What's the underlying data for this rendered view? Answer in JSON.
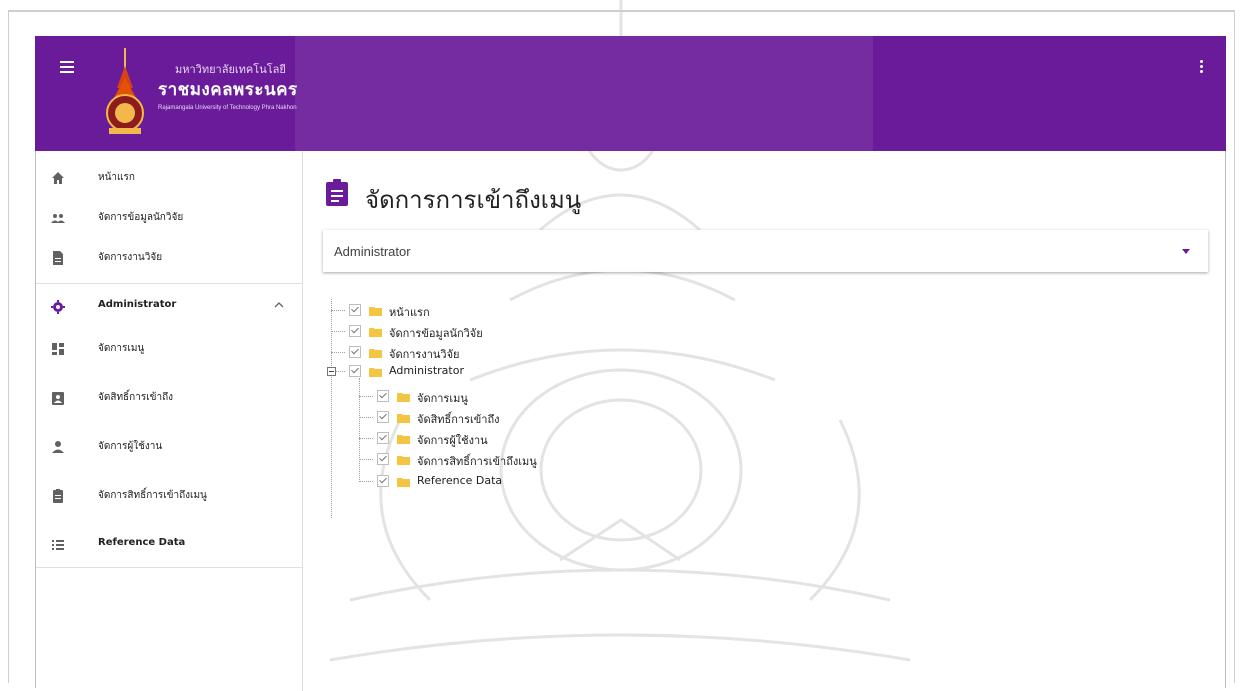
{
  "header": {
    "brand_small": "มหาวิทยาลัยเทคโนโลยี",
    "brand_big": "ราชมงคลพระนคร",
    "brand_en": "Rajamangala University of Technology Phra Nakhon",
    "accent_color": "#6a1b9a"
  },
  "sidebar": {
    "items": [
      {
        "label": "หน้าแรก",
        "icon": "home-icon"
      },
      {
        "label": "จัดการข้อมูลนักวิจัย",
        "icon": "people-icon"
      },
      {
        "label": "จัดการงานวิจัย",
        "icon": "document-icon"
      },
      {
        "label": "Administrator",
        "icon": "gear-icon",
        "expanded": true
      },
      {
        "label": "จัดการเมนู",
        "icon": "dashboard-icon"
      },
      {
        "label": "จัดสิทธิ์การเข้าถึง",
        "icon": "badge-icon"
      },
      {
        "label": "จัดการผู้ใช้งาน",
        "icon": "person-icon"
      },
      {
        "label": "จัดการสิทธิ์การเข้าถึงเมนู",
        "icon": "clipboard-icon"
      },
      {
        "label": "Reference Data",
        "icon": "list-icon"
      }
    ]
  },
  "main": {
    "title": "จัดการการเข้าถึงเมนู",
    "role_select": {
      "value": "Administrator"
    },
    "tree": [
      {
        "label": "หน้าแรก",
        "checked": true
      },
      {
        "label": "จัดการข้อมูลนักวิจัย",
        "checked": true
      },
      {
        "label": "จัดการงานวิจัย",
        "checked": true
      },
      {
        "label": "Administrator",
        "checked": true,
        "expanded": true,
        "children": [
          {
            "label": "จัดการเมนู",
            "checked": true
          },
          {
            "label": "จัดสิทธิ์การเข้าถึง",
            "checked": true
          },
          {
            "label": "จัดการผู้ใช้งาน",
            "checked": true
          },
          {
            "label": "จัดการสิทธิ์การเข้าถึงเมนู",
            "checked": true
          },
          {
            "label": "Reference Data",
            "checked": true
          }
        ]
      }
    ]
  }
}
